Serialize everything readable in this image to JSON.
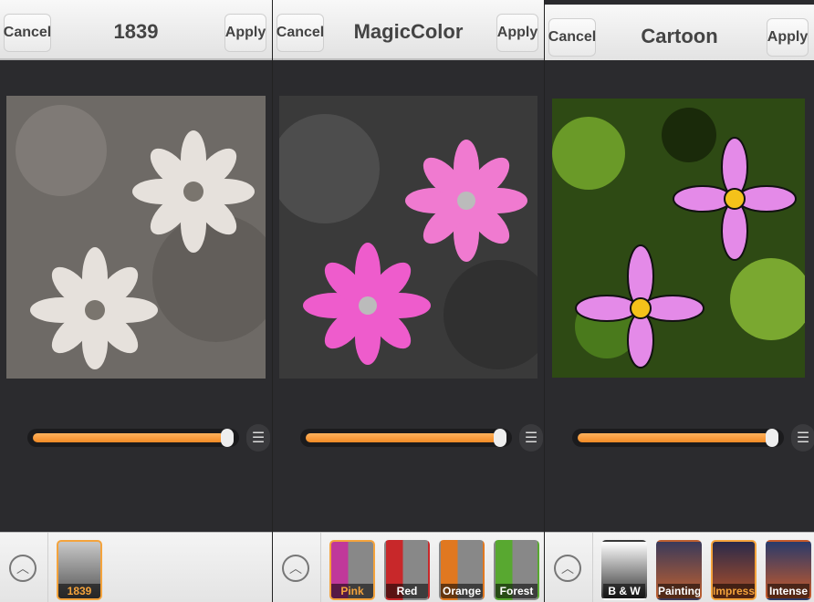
{
  "panels": [
    {
      "title": "1839",
      "cancel_label": "Cancel",
      "apply_label": "Apply",
      "slider_value": 1.0,
      "filters": [
        {
          "label": "1839",
          "selected": true
        }
      ]
    },
    {
      "title": "MagicColor",
      "cancel_label": "Cancel",
      "apply_label": "Apply",
      "slider_value": 1.0,
      "filters": [
        {
          "label": "Pink",
          "selected": true,
          "color": "#c0389a"
        },
        {
          "label": "Red",
          "selected": false,
          "color": "#c8282a"
        },
        {
          "label": "Orange",
          "selected": false,
          "color": "#e07820"
        },
        {
          "label": "Forest",
          "selected": false,
          "color": "#58a830"
        }
      ]
    },
    {
      "title": "Cartoon",
      "cancel_label": "Cancel",
      "apply_label": "Apply",
      "slider_value": 1.0,
      "filters": [
        {
          "label": "B & W",
          "selected": false
        },
        {
          "label": "Painting",
          "selected": false
        },
        {
          "label": "Impress",
          "selected": true
        },
        {
          "label": "Intense",
          "selected": false
        }
      ]
    }
  ],
  "icons": {
    "adjust": "☰",
    "up": "︿"
  },
  "accent_color": "#f4a33c"
}
